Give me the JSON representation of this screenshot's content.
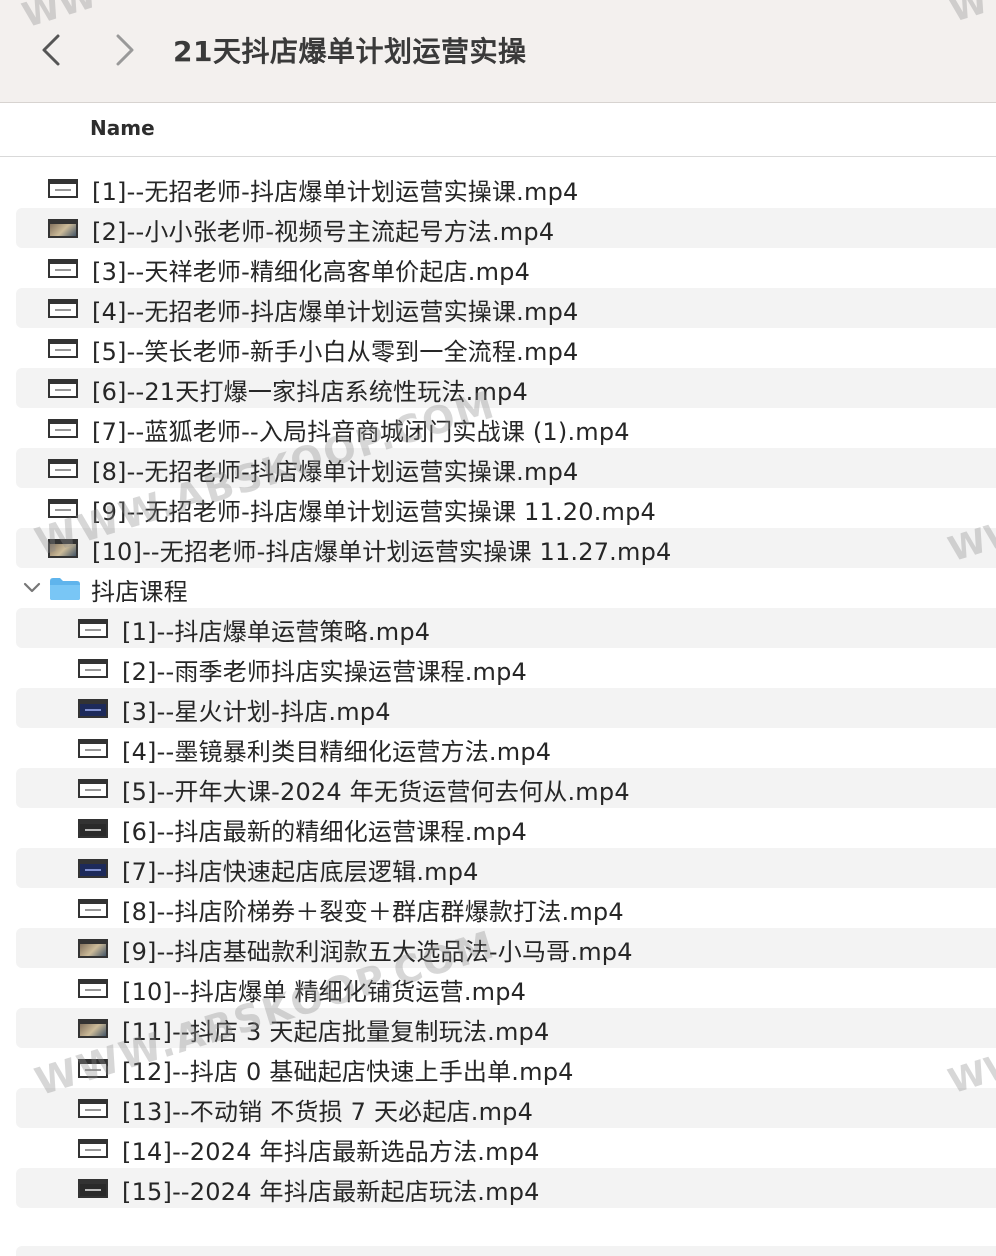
{
  "window": {
    "title": "21天抖店爆单计划运营实操"
  },
  "columns": {
    "name": "Name"
  },
  "files_top": [
    "[1]--无招老师-抖店爆单计划运营实操课.mp4",
    "[2]--小小张老师-视频号主流起号方法.mp4",
    "[3]--天祥老师-精细化高客单价起店.mp4",
    "[4]--无招老师-抖店爆单计划运营实操课.mp4",
    "[5]--笑长老师-新手小白从零到一全流程.mp4",
    "[6]--21天打爆一家抖店系统性玩法.mp4",
    "[7]--蓝狐老师--入局抖音商城闭门实战课 (1).mp4",
    "[8]--无招老师-抖店爆单计划运营实操课.mp4",
    "[9]--无招老师-抖店爆单计划运营实操课 11.20.mp4",
    "[10]--无招老师-抖店爆单计划运营实操课 11.27.mp4"
  ],
  "folder": {
    "name": "抖店课程"
  },
  "files_sub": [
    "[1]--抖店爆单运营策略.mp4",
    "[2]--雨季老师抖店实操运营课程.mp4",
    "[3]--星火计划-抖店.mp4",
    "[4]--墨镜暴利类目精细化运营方法.mp4",
    "[5]--开年大课-2024 年无货运营何去何从.mp4",
    "[6]--抖店最新的精细化运营课程.mp4",
    "[7]--抖店快速起店底层逻辑.mp4",
    "[8]--抖店阶梯券＋裂变＋群店群爆款打法.mp4",
    "[9]--抖店基础款利润款五大选品法-小马哥.mp4",
    "[10]--抖店爆单 精细化铺货运营.mp4",
    "[11]--抖店 3 天起店批量复制玩法.mp4",
    "[12]--抖店 0 基础起店快速上手出单.mp4",
    "[13]--不动销 不货损 7 天必起店.mp4",
    "[14]--2024 年抖店最新选品方法.mp4",
    "[15]--2024 年抖店最新起店玩法.mp4"
  ],
  "watermarks": {
    "main": "WWW.ABSKOOP.COM",
    "edge": "WW",
    "top_left": "WW",
    "top_right": "W"
  },
  "icons": {
    "back": "chevron-left-icon",
    "forward": "chevron-right-icon",
    "disclosure": "chevron-down-icon",
    "folder": "folder-icon",
    "file": "video-thumbnail-icon"
  }
}
